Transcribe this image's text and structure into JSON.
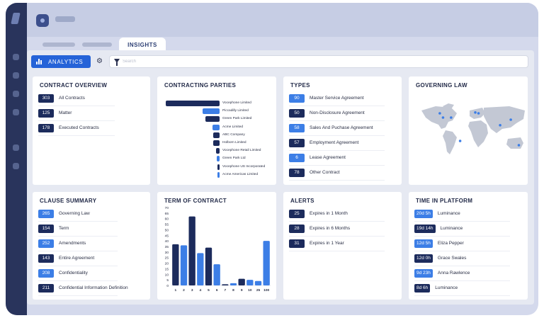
{
  "tabs": {
    "active": "INSIGHTS"
  },
  "toolbar": {
    "analytics_label": "ANALYTICS",
    "search_placeholder": "Search"
  },
  "colors": {
    "dark": "#1c2b5c",
    "light": "#3c7ee6",
    "accent": "#2563d8"
  },
  "contract_overview": {
    "title": "CONTRACT OVERVIEW",
    "items": [
      {
        "value": "303",
        "label": "All Contracts",
        "tone": "dark"
      },
      {
        "value": "125",
        "label": "Matter",
        "tone": "dark"
      },
      {
        "value": "178",
        "label": "Executed Contracts",
        "tone": "dark"
      }
    ]
  },
  "contracting_parties": {
    "title": "CONTRACTING PARTIES",
    "chart_data": {
      "type": "bar",
      "orientation": "horizontal",
      "categories": [
        "Vocephone Limited",
        "Piccadilly Limited",
        "Green Park Limited",
        "Acme Limited",
        "ABC Company",
        "Holborn Limited",
        "Vocephone Retail Limited",
        "Green Park Ltd",
        "Vocephone US Incorporated",
        "Acme Americas Limited"
      ],
      "values": [
        70,
        22,
        18,
        9,
        8,
        8,
        5,
        4,
        3,
        3
      ],
      "tones": [
        "dark",
        "light",
        "dark",
        "light",
        "dark",
        "dark",
        "dark",
        "light",
        "dark",
        "light"
      ]
    }
  },
  "types": {
    "title": "TYPES",
    "items": [
      {
        "value": "90",
        "label": "Master Service Agreement",
        "tone": "light"
      },
      {
        "value": "50",
        "label": "Non-Disclosure Agreement",
        "tone": "dark"
      },
      {
        "value": "58",
        "label": "Sales And Puchase Agreement",
        "tone": "light"
      },
      {
        "value": "57",
        "label": "Employment Agreement",
        "tone": "dark"
      },
      {
        "value": "6",
        "label": "Lease Agreement",
        "tone": "light"
      },
      {
        "value": "78",
        "label": "Other Contract",
        "tone": "dark"
      }
    ]
  },
  "governing_law": {
    "title": "GOVERNING LAW",
    "markers": [
      {
        "lon": -100,
        "lat": 40
      },
      {
        "lon": -75,
        "lat": 40
      },
      {
        "lon": -110,
        "lat": 50
      },
      {
        "lon": 0,
        "lat": 52
      },
      {
        "lon": 10,
        "lat": 50
      },
      {
        "lon": 77,
        "lat": 22
      },
      {
        "lon": 110,
        "lat": 35
      },
      {
        "lon": 135,
        "lat": -25
      },
      {
        "lon": -47,
        "lat": -15
      }
    ]
  },
  "clause_summary": {
    "title": "CLAUSE SUMMARY",
    "items": [
      {
        "value": "265",
        "label": "Governing Law",
        "tone": "light"
      },
      {
        "value": "154",
        "label": "Term",
        "tone": "dark"
      },
      {
        "value": "252",
        "label": "Amendments",
        "tone": "light"
      },
      {
        "value": "143",
        "label": "Entire Agreement",
        "tone": "dark"
      },
      {
        "value": "208",
        "label": "Confidentiality",
        "tone": "light"
      },
      {
        "value": "211",
        "label": "Confidential Information Definition",
        "tone": "dark"
      }
    ]
  },
  "term_of_contract": {
    "title": "TERM OF CONTRACT",
    "chart_data": {
      "type": "bar",
      "categories": [
        "1",
        "2",
        "3",
        "4",
        "5",
        "6",
        "7",
        "8",
        "9",
        "10",
        "25",
        "100"
      ],
      "series": [
        {
          "values": [
            37,
            0,
            62,
            0,
            34,
            0,
            1,
            0,
            6,
            0,
            0,
            0
          ],
          "tone": "dark"
        },
        {
          "values": [
            0,
            36,
            0,
            29,
            0,
            19,
            0,
            2,
            0,
            5,
            4,
            40
          ],
          "tone": "light"
        }
      ],
      "ylim": [
        0,
        70
      ],
      "yticks": [
        0,
        5,
        10,
        15,
        20,
        25,
        30,
        35,
        40,
        45,
        50,
        55,
        60,
        65,
        70
      ]
    }
  },
  "alerts": {
    "title": "ALERTS",
    "items": [
      {
        "value": "25",
        "label": "Expires in 1 Month",
        "tone": "dark"
      },
      {
        "value": "28",
        "label": "Expires in 6 Months",
        "tone": "dark"
      },
      {
        "value": "31",
        "label": "Expires in 1 Year",
        "tone": "dark"
      }
    ]
  },
  "time_in_platform": {
    "title": "TIME IN PLATFORM",
    "items": [
      {
        "value": "20d 5h",
        "label": "Luminance",
        "tone": "light"
      },
      {
        "value": "19d 14h",
        "label": "Luminance",
        "tone": "dark"
      },
      {
        "value": "12d 5h",
        "label": "Eliza Pepper",
        "tone": "light"
      },
      {
        "value": "12d 0h",
        "label": "Grace Swales",
        "tone": "dark"
      },
      {
        "value": "9d 23h",
        "label": "Anna Rawlence",
        "tone": "light"
      },
      {
        "value": "8d 6h",
        "label": "Luminance",
        "tone": "dark"
      }
    ]
  }
}
